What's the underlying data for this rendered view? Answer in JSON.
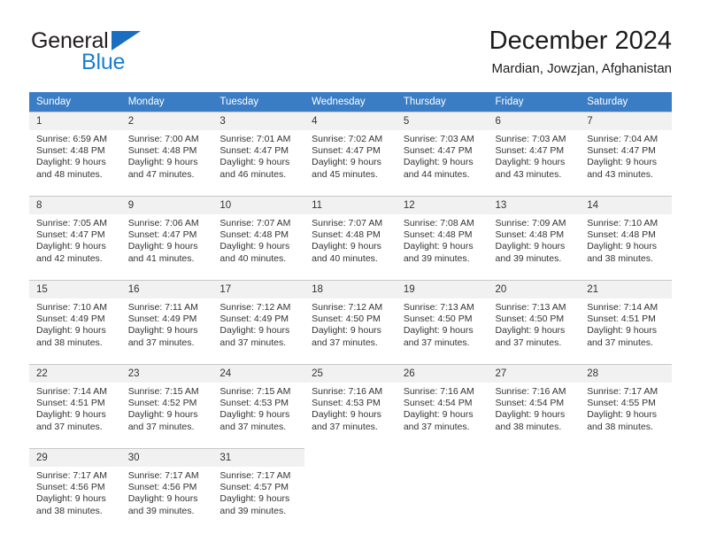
{
  "brand": {
    "name_part1": "General",
    "name_part2": "Blue",
    "triangle_color": "#1a6ec0",
    "blue_color": "#1a7fd4"
  },
  "header": {
    "title": "December 2024",
    "subtitle": "Mardian, Jowzjan, Afghanistan",
    "header_bg": "#3a7dc4",
    "daynum_bg": "#f1f1f1"
  },
  "weekdays": [
    "Sunday",
    "Monday",
    "Tuesday",
    "Wednesday",
    "Thursday",
    "Friday",
    "Saturday"
  ],
  "weeks": [
    [
      {
        "day": "1",
        "sunrise": "Sunrise: 6:59 AM",
        "sunset": "Sunset: 4:48 PM",
        "daylight1": "Daylight: 9 hours",
        "daylight2": "and 48 minutes."
      },
      {
        "day": "2",
        "sunrise": "Sunrise: 7:00 AM",
        "sunset": "Sunset: 4:48 PM",
        "daylight1": "Daylight: 9 hours",
        "daylight2": "and 47 minutes."
      },
      {
        "day": "3",
        "sunrise": "Sunrise: 7:01 AM",
        "sunset": "Sunset: 4:47 PM",
        "daylight1": "Daylight: 9 hours",
        "daylight2": "and 46 minutes."
      },
      {
        "day": "4",
        "sunrise": "Sunrise: 7:02 AM",
        "sunset": "Sunset: 4:47 PM",
        "daylight1": "Daylight: 9 hours",
        "daylight2": "and 45 minutes."
      },
      {
        "day": "5",
        "sunrise": "Sunrise: 7:03 AM",
        "sunset": "Sunset: 4:47 PM",
        "daylight1": "Daylight: 9 hours",
        "daylight2": "and 44 minutes."
      },
      {
        "day": "6",
        "sunrise": "Sunrise: 7:03 AM",
        "sunset": "Sunset: 4:47 PM",
        "daylight1": "Daylight: 9 hours",
        "daylight2": "and 43 minutes."
      },
      {
        "day": "7",
        "sunrise": "Sunrise: 7:04 AM",
        "sunset": "Sunset: 4:47 PM",
        "daylight1": "Daylight: 9 hours",
        "daylight2": "and 43 minutes."
      }
    ],
    [
      {
        "day": "8",
        "sunrise": "Sunrise: 7:05 AM",
        "sunset": "Sunset: 4:47 PM",
        "daylight1": "Daylight: 9 hours",
        "daylight2": "and 42 minutes."
      },
      {
        "day": "9",
        "sunrise": "Sunrise: 7:06 AM",
        "sunset": "Sunset: 4:47 PM",
        "daylight1": "Daylight: 9 hours",
        "daylight2": "and 41 minutes."
      },
      {
        "day": "10",
        "sunrise": "Sunrise: 7:07 AM",
        "sunset": "Sunset: 4:48 PM",
        "daylight1": "Daylight: 9 hours",
        "daylight2": "and 40 minutes."
      },
      {
        "day": "11",
        "sunrise": "Sunrise: 7:07 AM",
        "sunset": "Sunset: 4:48 PM",
        "daylight1": "Daylight: 9 hours",
        "daylight2": "and 40 minutes."
      },
      {
        "day": "12",
        "sunrise": "Sunrise: 7:08 AM",
        "sunset": "Sunset: 4:48 PM",
        "daylight1": "Daylight: 9 hours",
        "daylight2": "and 39 minutes."
      },
      {
        "day": "13",
        "sunrise": "Sunrise: 7:09 AM",
        "sunset": "Sunset: 4:48 PM",
        "daylight1": "Daylight: 9 hours",
        "daylight2": "and 39 minutes."
      },
      {
        "day": "14",
        "sunrise": "Sunrise: 7:10 AM",
        "sunset": "Sunset: 4:48 PM",
        "daylight1": "Daylight: 9 hours",
        "daylight2": "and 38 minutes."
      }
    ],
    [
      {
        "day": "15",
        "sunrise": "Sunrise: 7:10 AM",
        "sunset": "Sunset: 4:49 PM",
        "daylight1": "Daylight: 9 hours",
        "daylight2": "and 38 minutes."
      },
      {
        "day": "16",
        "sunrise": "Sunrise: 7:11 AM",
        "sunset": "Sunset: 4:49 PM",
        "daylight1": "Daylight: 9 hours",
        "daylight2": "and 37 minutes."
      },
      {
        "day": "17",
        "sunrise": "Sunrise: 7:12 AM",
        "sunset": "Sunset: 4:49 PM",
        "daylight1": "Daylight: 9 hours",
        "daylight2": "and 37 minutes."
      },
      {
        "day": "18",
        "sunrise": "Sunrise: 7:12 AM",
        "sunset": "Sunset: 4:50 PM",
        "daylight1": "Daylight: 9 hours",
        "daylight2": "and 37 minutes."
      },
      {
        "day": "19",
        "sunrise": "Sunrise: 7:13 AM",
        "sunset": "Sunset: 4:50 PM",
        "daylight1": "Daylight: 9 hours",
        "daylight2": "and 37 minutes."
      },
      {
        "day": "20",
        "sunrise": "Sunrise: 7:13 AM",
        "sunset": "Sunset: 4:50 PM",
        "daylight1": "Daylight: 9 hours",
        "daylight2": "and 37 minutes."
      },
      {
        "day": "21",
        "sunrise": "Sunrise: 7:14 AM",
        "sunset": "Sunset: 4:51 PM",
        "daylight1": "Daylight: 9 hours",
        "daylight2": "and 37 minutes."
      }
    ],
    [
      {
        "day": "22",
        "sunrise": "Sunrise: 7:14 AM",
        "sunset": "Sunset: 4:51 PM",
        "daylight1": "Daylight: 9 hours",
        "daylight2": "and 37 minutes."
      },
      {
        "day": "23",
        "sunrise": "Sunrise: 7:15 AM",
        "sunset": "Sunset: 4:52 PM",
        "daylight1": "Daylight: 9 hours",
        "daylight2": "and 37 minutes."
      },
      {
        "day": "24",
        "sunrise": "Sunrise: 7:15 AM",
        "sunset": "Sunset: 4:53 PM",
        "daylight1": "Daylight: 9 hours",
        "daylight2": "and 37 minutes."
      },
      {
        "day": "25",
        "sunrise": "Sunrise: 7:16 AM",
        "sunset": "Sunset: 4:53 PM",
        "daylight1": "Daylight: 9 hours",
        "daylight2": "and 37 minutes."
      },
      {
        "day": "26",
        "sunrise": "Sunrise: 7:16 AM",
        "sunset": "Sunset: 4:54 PM",
        "daylight1": "Daylight: 9 hours",
        "daylight2": "and 37 minutes."
      },
      {
        "day": "27",
        "sunrise": "Sunrise: 7:16 AM",
        "sunset": "Sunset: 4:54 PM",
        "daylight1": "Daylight: 9 hours",
        "daylight2": "and 38 minutes."
      },
      {
        "day": "28",
        "sunrise": "Sunrise: 7:17 AM",
        "sunset": "Sunset: 4:55 PM",
        "daylight1": "Daylight: 9 hours",
        "daylight2": "and 38 minutes."
      }
    ],
    [
      {
        "day": "29",
        "sunrise": "Sunrise: 7:17 AM",
        "sunset": "Sunset: 4:56 PM",
        "daylight1": "Daylight: 9 hours",
        "daylight2": "and 38 minutes."
      },
      {
        "day": "30",
        "sunrise": "Sunrise: 7:17 AM",
        "sunset": "Sunset: 4:56 PM",
        "daylight1": "Daylight: 9 hours",
        "daylight2": "and 39 minutes."
      },
      {
        "day": "31",
        "sunrise": "Sunrise: 7:17 AM",
        "sunset": "Sunset: 4:57 PM",
        "daylight1": "Daylight: 9 hours",
        "daylight2": "and 39 minutes."
      },
      {
        "day": "",
        "sunrise": "",
        "sunset": "",
        "daylight1": "",
        "daylight2": ""
      },
      {
        "day": "",
        "sunrise": "",
        "sunset": "",
        "daylight1": "",
        "daylight2": ""
      },
      {
        "day": "",
        "sunrise": "",
        "sunset": "",
        "daylight1": "",
        "daylight2": ""
      },
      {
        "day": "",
        "sunrise": "",
        "sunset": "",
        "daylight1": "",
        "daylight2": ""
      }
    ]
  ]
}
